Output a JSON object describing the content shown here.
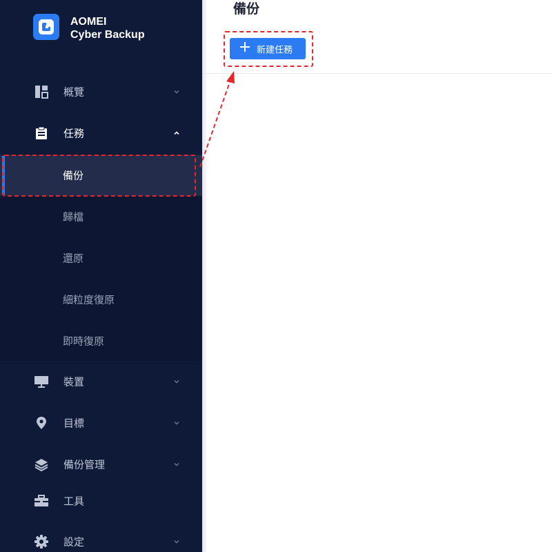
{
  "brand": {
    "line1": "AOMEI",
    "line2": "Cyber Backup",
    "logo_icon": "aomei-logo-icon",
    "accent_color": "#2b7bf2"
  },
  "sidebar": {
    "items": [
      {
        "label": "概覽",
        "icon": "dashboard-icon",
        "chevron": "down"
      },
      {
        "label": "任務",
        "icon": "clipboard-icon",
        "chevron": "up",
        "expanded": true
      },
      {
        "label": "裝置",
        "icon": "monitor-icon",
        "chevron": "down"
      },
      {
        "label": "目標",
        "icon": "location-pin-icon",
        "chevron": "down"
      },
      {
        "label": "備份管理",
        "icon": "layers-icon",
        "chevron": "down"
      },
      {
        "label": "工具",
        "icon": "toolbox-icon"
      },
      {
        "label": "設定",
        "icon": "gear-icon",
        "chevron": "down"
      }
    ],
    "task_submenu": [
      {
        "label": "備份",
        "selected": true
      },
      {
        "label": "歸檔"
      },
      {
        "label": "還原"
      },
      {
        "label": "細粒度復原"
      },
      {
        "label": "即時復原"
      }
    ]
  },
  "main": {
    "page_title": "備份",
    "new_task_button": "新建任務"
  },
  "annotation_color": "#e5262b"
}
